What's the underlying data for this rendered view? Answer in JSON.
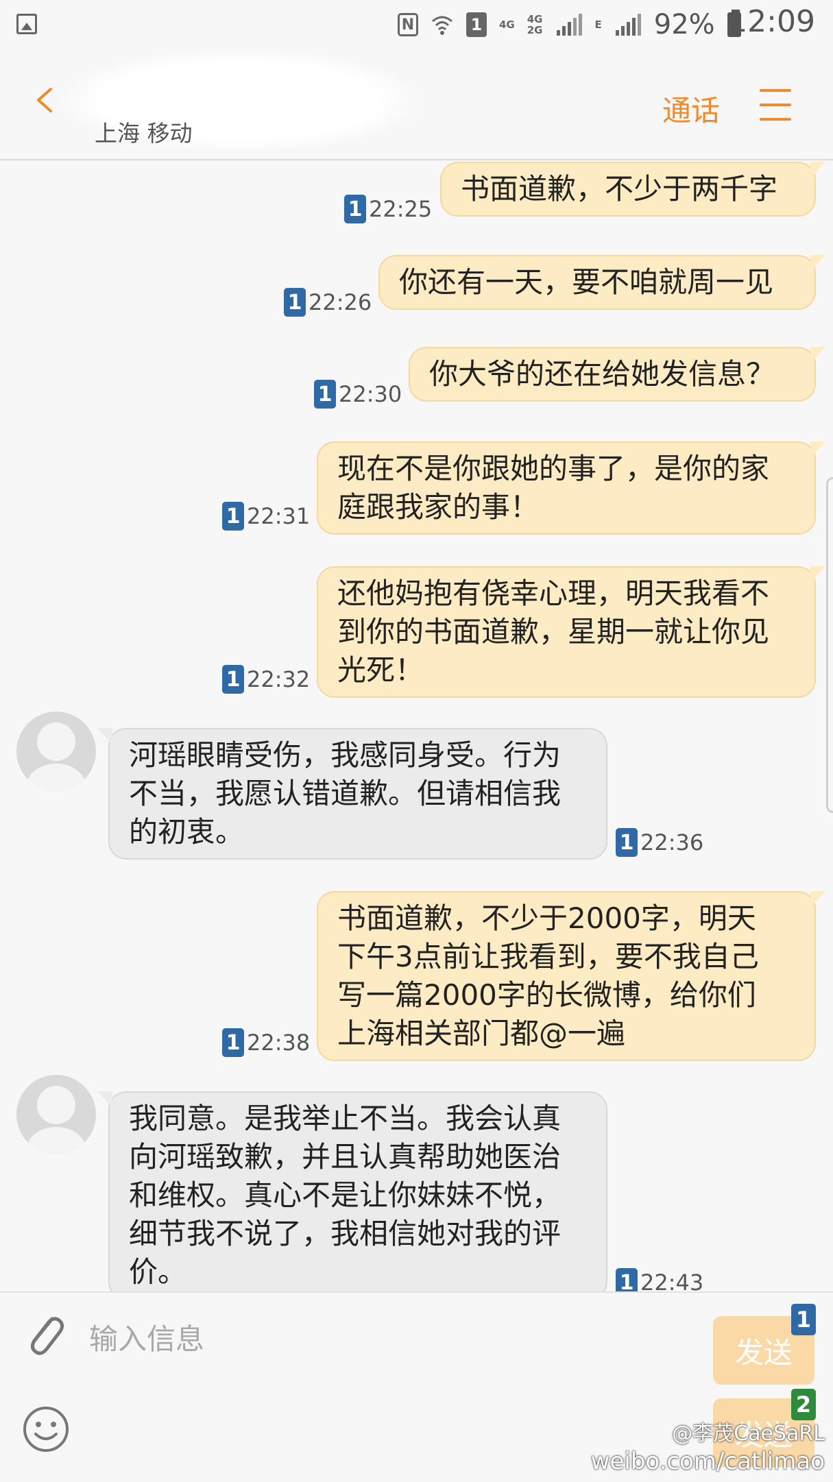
{
  "status_bar": {
    "nfc": "N",
    "sim": "1",
    "net_1": "4G",
    "net_2": "4G",
    "net_3": "2G",
    "net_4": "E",
    "battery": "92%",
    "time": "12:09"
  },
  "header": {
    "carrier": "上海 移动",
    "call_label": "通话"
  },
  "messages": [
    {
      "dir": "out",
      "sim": "1",
      "time": "22:25",
      "lines": [
        "书面道歉，不少于两千字"
      ]
    },
    {
      "dir": "out",
      "sim": "1",
      "time": "22:26",
      "lines": [
        "你还有一天，要不咱就周一见"
      ]
    },
    {
      "dir": "out",
      "sim": "1",
      "time": "22:30",
      "lines": [
        "你大爷的还在给她发信息？"
      ]
    },
    {
      "dir": "out",
      "sim": "1",
      "time": "22:31",
      "lines": [
        "现在不是你跟她的事了，是你的家",
        "庭跟我家的事！"
      ]
    },
    {
      "dir": "out",
      "sim": "1",
      "time": "22:32",
      "lines": [
        "还他妈抱有侥幸心理，明天我看不",
        "到你的书面道歉，星期一就让你见",
        "光死！"
      ]
    },
    {
      "dir": "in",
      "sim": "1",
      "time": "22:36",
      "lines": [
        "河瑶眼睛受伤，我感同身受。行为",
        "不当，我愿认错道歉。但请相信我",
        "的初衷。"
      ]
    },
    {
      "dir": "out",
      "sim": "1",
      "time": "22:38",
      "lines": [
        "书面道歉，不少于2000字，明天",
        "下午3点前让我看到，要不我自己",
        "写一篇2000字的长微博，给你们",
        "上海相关部门都@一遍"
      ]
    },
    {
      "dir": "in",
      "sim": "1",
      "time": "22:43",
      "lines": [
        "我同意。是我举止不当。我会认真",
        "向河瑶致歉，并且认真帮助她医治",
        "和维权。真心不是让你妹妹不悦，",
        "细节我不说了，我相信她对我的评",
        "价。"
      ]
    }
  ],
  "composer": {
    "placeholder": "输入信息",
    "send_1_label": "发送",
    "send_1_sim": "1",
    "send_2_label": "发送",
    "send_2_sim": "2"
  },
  "watermark": {
    "handle": "@李茂CaeSaRL",
    "url": "weibo.com/catlimao"
  },
  "colors": {
    "accent": "#f08a2a",
    "outgoing_bubble": "#fdebc4",
    "incoming_bubble": "#ebebeb",
    "sim1_badge": "#2f6aa6",
    "sim2_badge": "#2e8b3e",
    "send_button": "#fbd9a7"
  }
}
